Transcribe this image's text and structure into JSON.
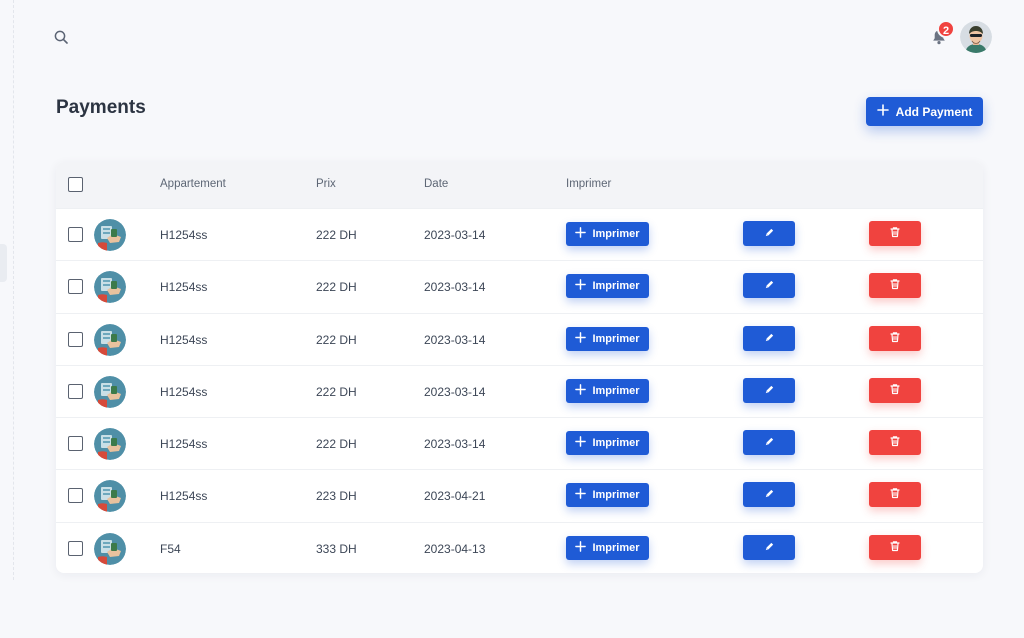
{
  "header": {
    "notification_count": "2"
  },
  "page": {
    "title": "Payments",
    "add_button_label": "Add Payment"
  },
  "table": {
    "columns": [
      "Appartement",
      "Prix",
      "Date",
      "Imprimer"
    ],
    "print_label": "Imprimer",
    "rows": [
      {
        "appartement": "H1254ss",
        "prix": "222 DH",
        "date": "2023-03-14"
      },
      {
        "appartement": "H1254ss",
        "prix": "222 DH",
        "date": "2023-03-14"
      },
      {
        "appartement": "H1254ss",
        "prix": "222 DH",
        "date": "2023-03-14"
      },
      {
        "appartement": "H1254ss",
        "prix": "222 DH",
        "date": "2023-03-14"
      },
      {
        "appartement": "H1254ss",
        "prix": "222 DH",
        "date": "2023-03-14"
      },
      {
        "appartement": "H1254ss",
        "prix": "223 DH",
        "date": "2023-04-21"
      },
      {
        "appartement": "F54",
        "prix": "333 DH",
        "date": "2023-04-13"
      }
    ]
  },
  "colors": {
    "primary": "#1f5bd6",
    "danger": "#f0433f",
    "background": "#f7f8fb"
  }
}
